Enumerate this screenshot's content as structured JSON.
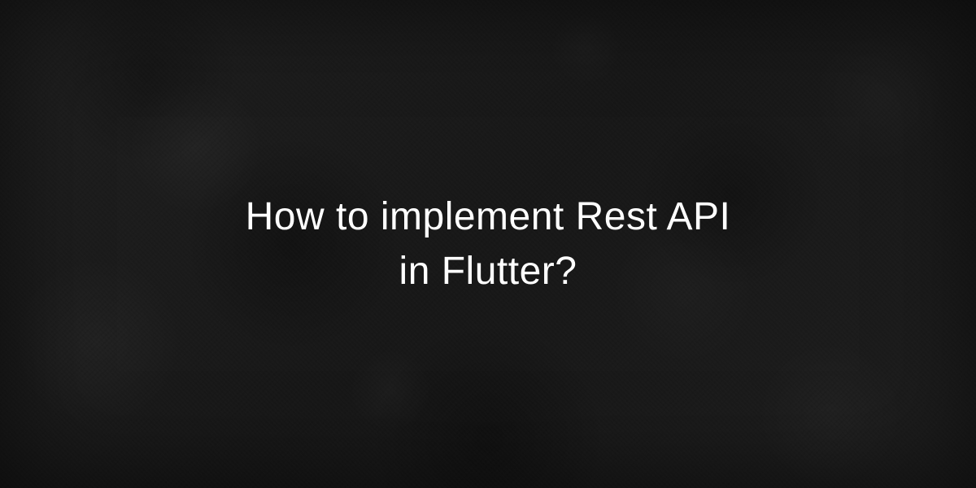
{
  "title": {
    "line1": "How to implement Rest API",
    "line2": "in Flutter?"
  }
}
